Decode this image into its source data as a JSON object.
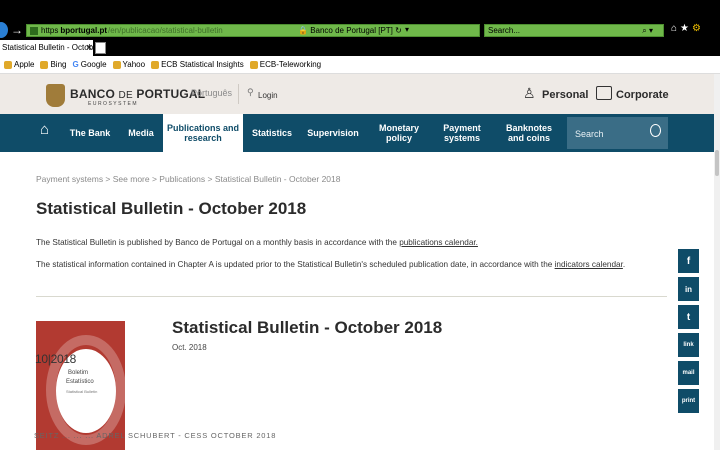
{
  "browser": {
    "url_scheme": "https",
    "url_domain": "bportugal.pt",
    "url_path": "/en/publicacao/statistical-bulletin",
    "site_identity": "Banco de Portugal [PT]",
    "search_placeholder": "Search...",
    "tab_title": "Statistical Bulletin - Octobe...",
    "favorites": [
      {
        "label": "Apple"
      },
      {
        "label": "Bing"
      },
      {
        "label": "Google"
      },
      {
        "label": "Yahoo"
      },
      {
        "label": "ECB Statistical Insights"
      },
      {
        "label": "ECB-Teleworking"
      }
    ]
  },
  "header": {
    "logo_main": "BANCO",
    "logo_de": "DE",
    "logo_end": "PORTUGAL",
    "logo_sub": "EUROSYSTEM",
    "language": "Português",
    "login": "Login",
    "personal": "Personal",
    "corporate": "Corporate"
  },
  "nav": {
    "items": [
      {
        "label": "The Bank"
      },
      {
        "label": "Media"
      },
      {
        "label": "Publications and research"
      },
      {
        "label": "Statistics"
      },
      {
        "label": "Supervision"
      },
      {
        "label": "Monetary policy"
      },
      {
        "label": "Payment systems"
      },
      {
        "label": "Banknotes and coins"
      }
    ],
    "search_placeholder": "Search"
  },
  "content": {
    "breadcrumb": "Payment systems > See more > Publications > Statistical Bulletin - October 2018",
    "title": "Statistical Bulletin - October 2018",
    "para1_text": "The Statistical Bulletin is published by Banco de Portugal on a monthly basis in accordance with the ",
    "para1_link": "publications calendar.",
    "para2_text": "The statistical information contained in Chapter A is updated prior to the Statistical Bulletin's scheduled publication date, in accordance with the ",
    "para2_link": "indicators calendar",
    "para2_end": ".",
    "publication": {
      "cover_date": "10|2018",
      "cover_title1": "Boletim",
      "cover_title2": "Estatístico",
      "cover_title3": "Statistical Bulletin",
      "title": "Statistical Bulletin - October 2018",
      "date": "Oct. 2018"
    }
  },
  "footer_caption": "SEITZ ... ... ... ADREL SCHUBERT - CESS OCTOBER 2018",
  "share": [
    "f",
    "in",
    "t",
    "link",
    "mail",
    "print"
  ],
  "colors": {
    "nav_bg": "#0f4c68",
    "header_bg": "#eeeae6",
    "browser_green": "#6fb84a",
    "cover_red": "#b23a31"
  }
}
